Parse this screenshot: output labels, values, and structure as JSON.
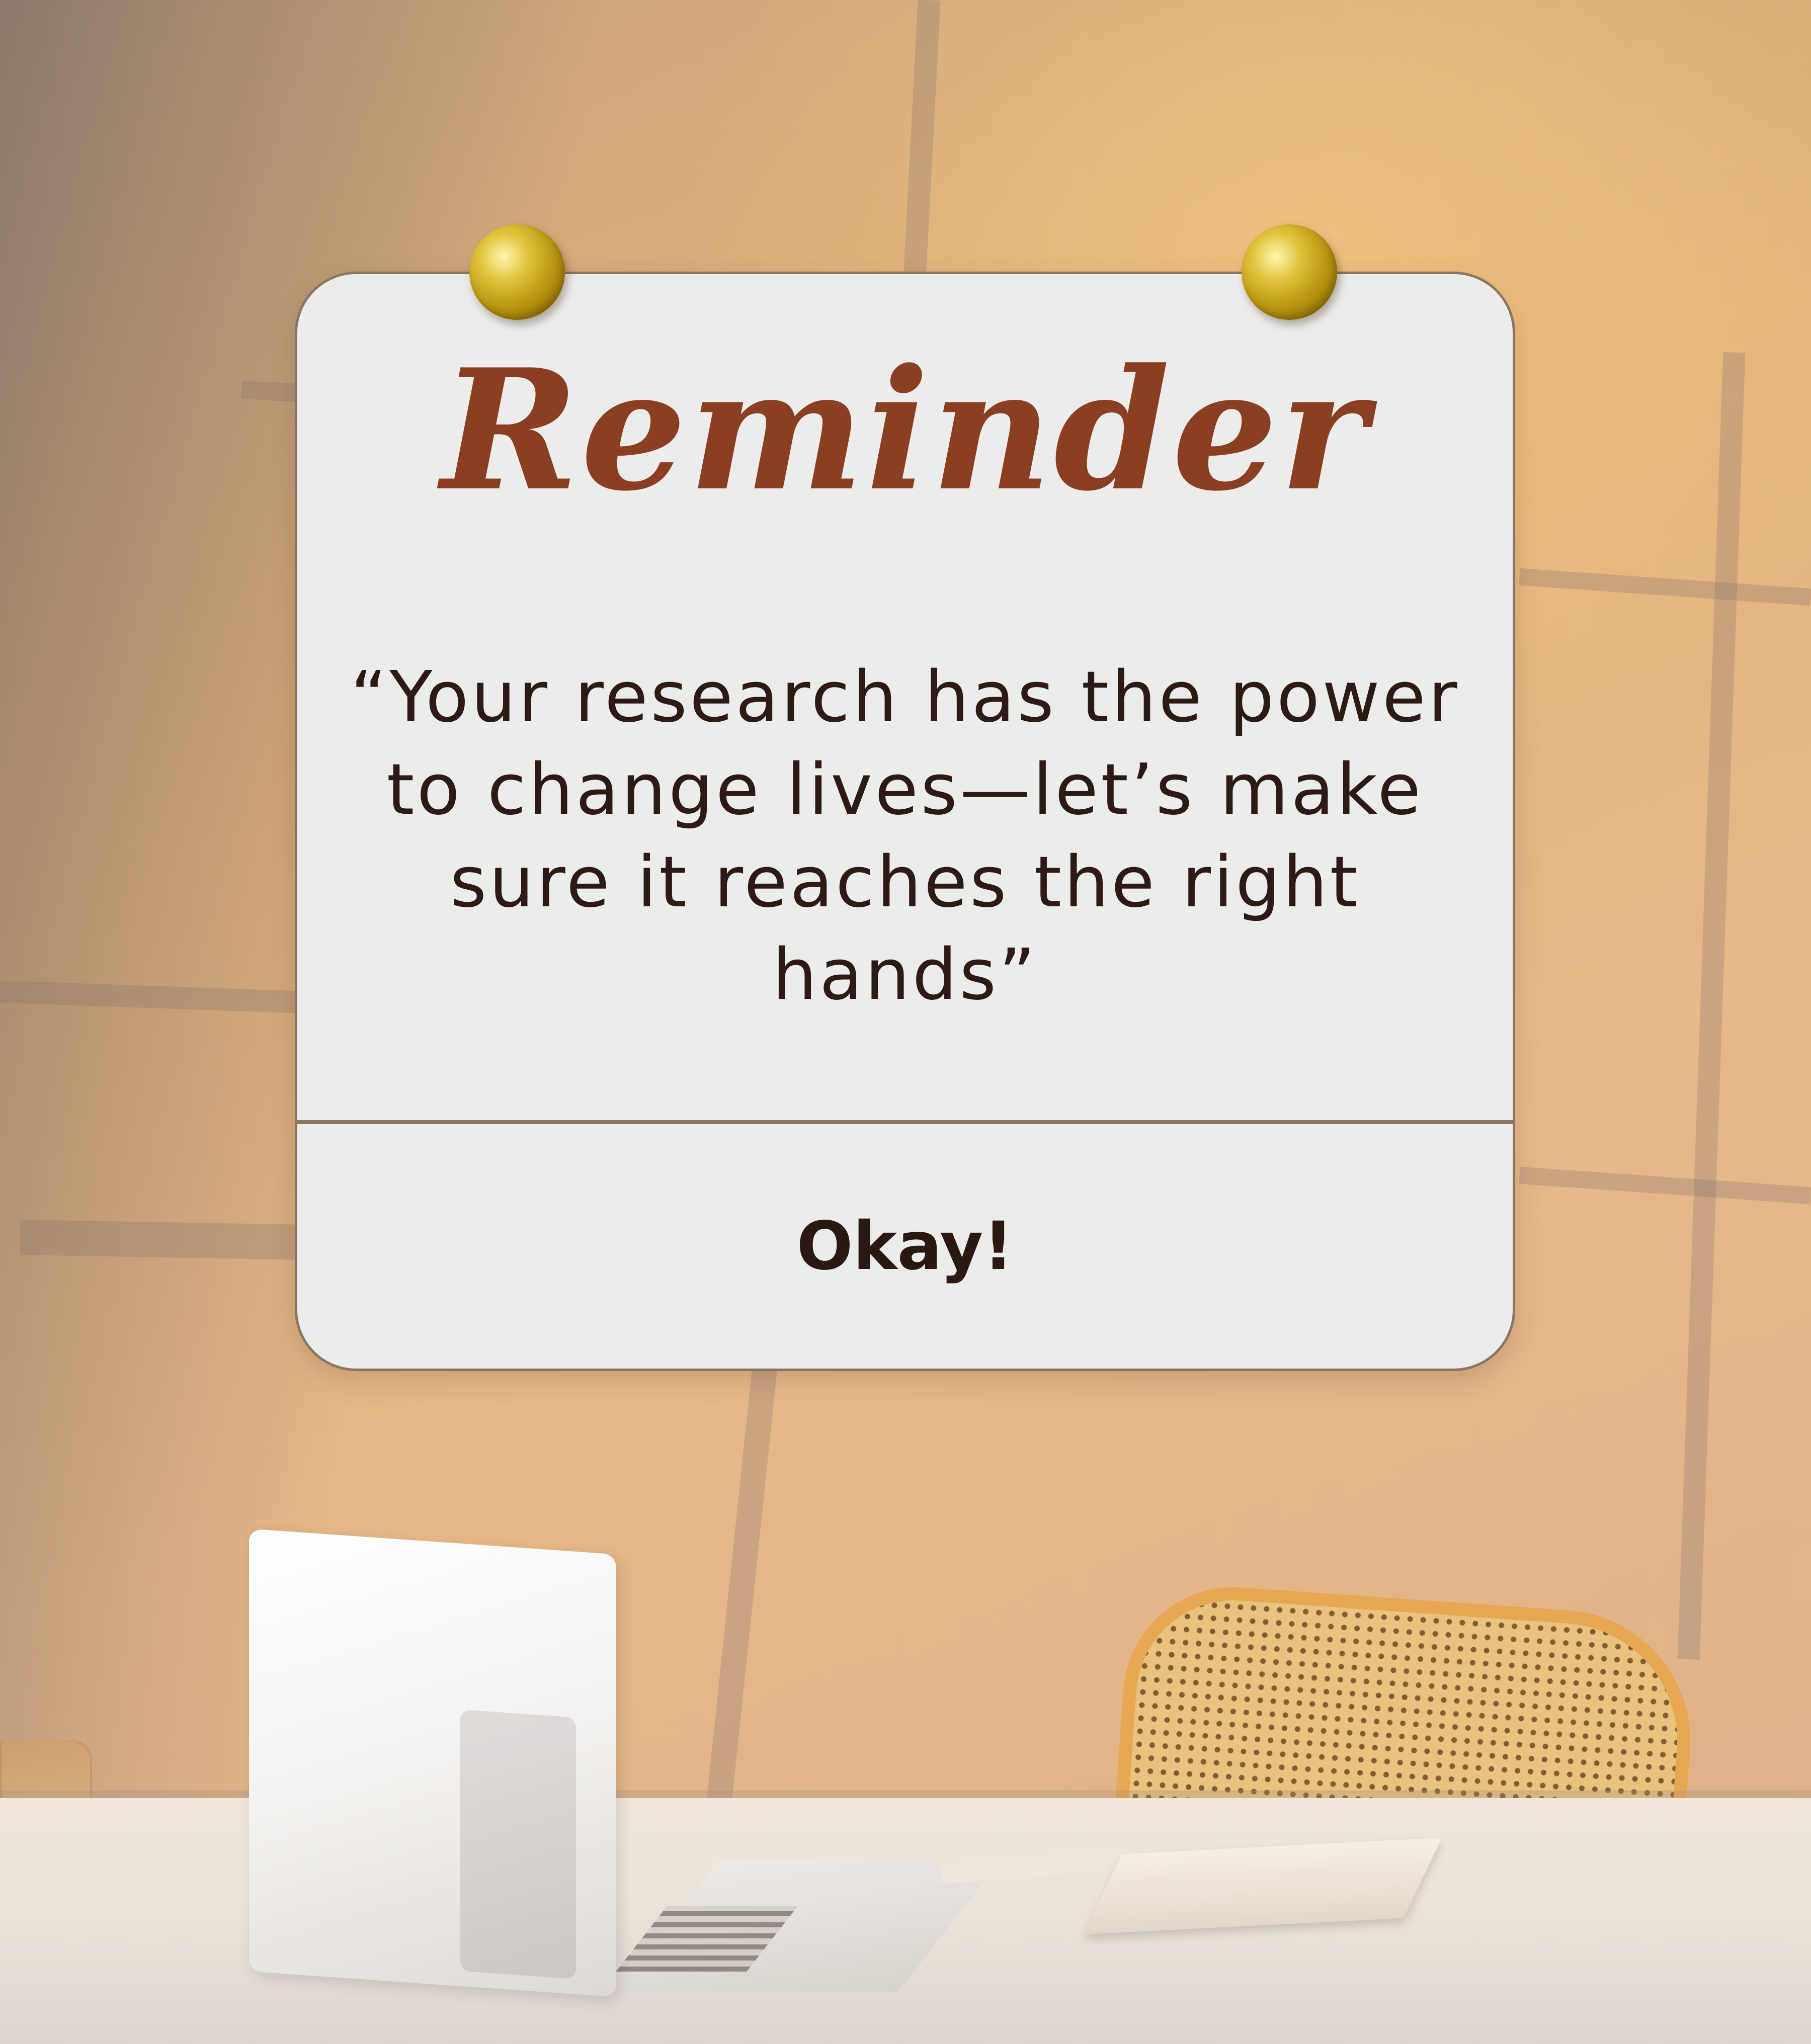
{
  "reminder_card": {
    "title": "Reminder",
    "quote_lines": [
      "“Your research has the power",
      "to change lives—let’s make",
      "sure it reaches the right hands”"
    ],
    "action_label": "Okay!"
  },
  "colors": {
    "title": "#8b3f22",
    "quote_text": "#2e1a14",
    "card_background": "#ececeb",
    "card_border": "#8b7563",
    "pin_gold": "#c9a51c",
    "wall": "#e2b27a"
  },
  "icons": {
    "left_pin": "pushpin-icon",
    "right_pin": "pushpin-icon"
  }
}
